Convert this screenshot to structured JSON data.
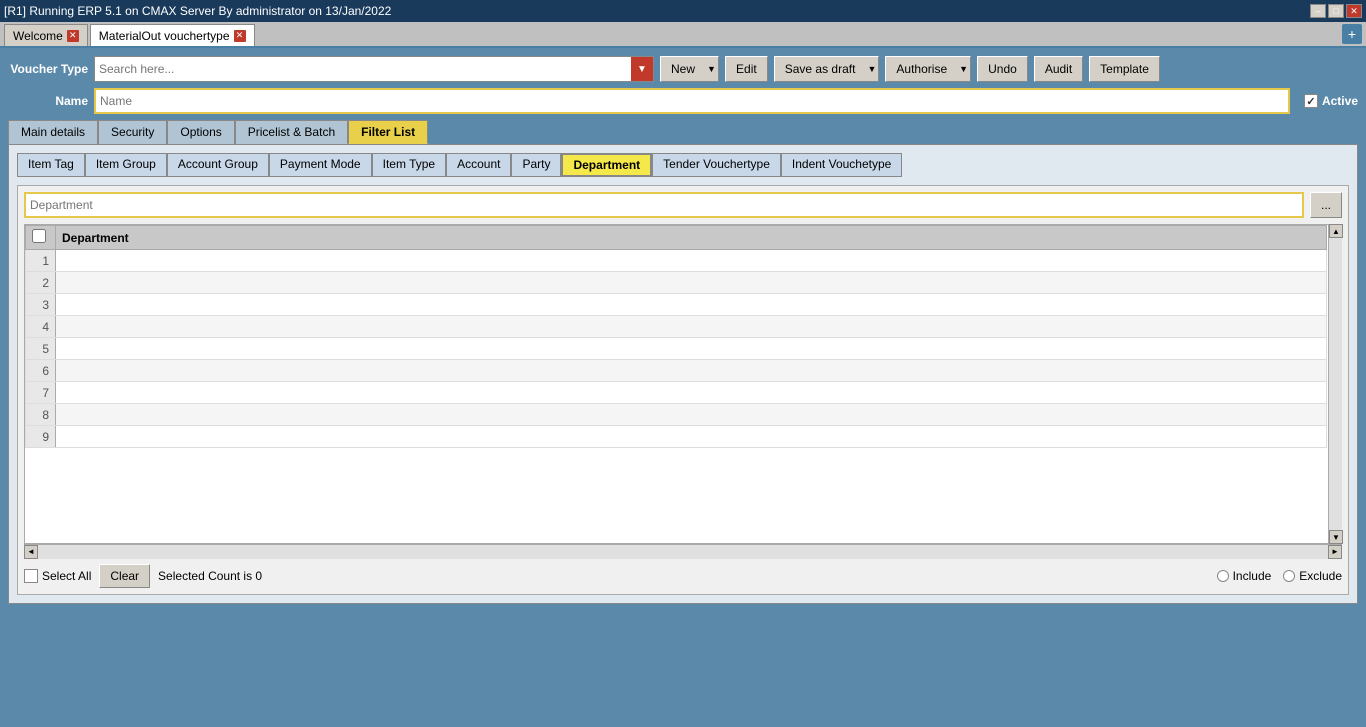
{
  "titlebar": {
    "title": "[R1] Running ERP 5.1 on CMAX Server By administrator on 13/Jan/2022"
  },
  "tabs": [
    {
      "label": "Welcome",
      "active": false,
      "closable": true
    },
    {
      "label": "MaterialOut vouchertype",
      "active": true,
      "closable": true
    }
  ],
  "toolbar": {
    "voucher_type_label": "Voucher Type",
    "search_placeholder": "Search here...",
    "new_label": "New",
    "edit_label": "Edit",
    "save_as_draft_label": "Save as draft",
    "authorise_label": "Authorise",
    "undo_label": "Undo",
    "audit_label": "Audit",
    "template_label": "Template"
  },
  "form": {
    "name_label": "Name",
    "name_placeholder": "Name",
    "active_label": "Active",
    "active_checked": true
  },
  "sub_tabs": [
    {
      "label": "Main details",
      "active": false
    },
    {
      "label": "Security",
      "active": false
    },
    {
      "label": "Options",
      "active": false
    },
    {
      "label": "Pricelist & Batch",
      "active": false
    },
    {
      "label": "Filter List",
      "active": true
    }
  ],
  "filter_tabs": [
    {
      "label": "Item Tag",
      "active": false
    },
    {
      "label": "Item Group",
      "active": false
    },
    {
      "label": "Account Group",
      "active": false
    },
    {
      "label": "Payment Mode",
      "active": false
    },
    {
      "label": "Item Type",
      "active": false
    },
    {
      "label": "Account",
      "active": false
    },
    {
      "label": "Party",
      "active": false
    },
    {
      "label": "Department",
      "active": true
    },
    {
      "label": "Tender Vouchertype",
      "active": false
    },
    {
      "label": "Indent Vouchetype",
      "active": false
    }
  ],
  "department": {
    "search_placeholder": "Department",
    "browse_label": "...",
    "table": {
      "checkbox_header": "",
      "column": "Department",
      "rows": [
        1,
        2,
        3,
        4,
        5,
        6,
        7,
        8,
        9
      ]
    }
  },
  "bottom_bar": {
    "select_all_label": "Select All",
    "clear_label": "Clear",
    "selected_count_label": "Selected Count is 0",
    "include_label": "Include",
    "exclude_label": "Exclude"
  }
}
